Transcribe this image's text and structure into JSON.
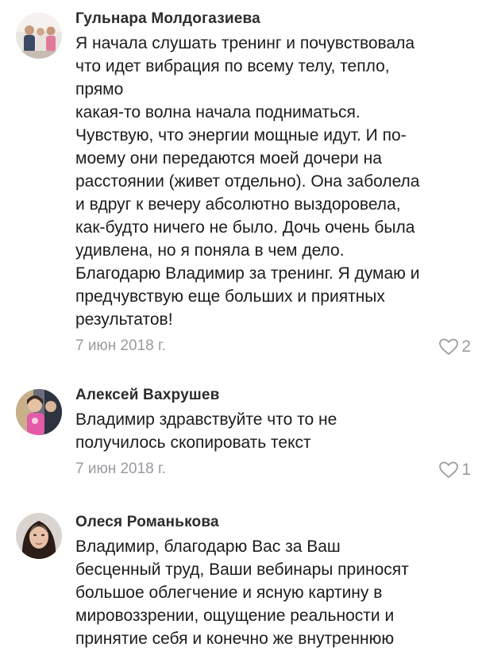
{
  "comments": [
    {
      "author": "Гульнара Молдогазиева",
      "text": "Я начала слушать тренинг и почувствовала\nчто идет вибрация по всему телу, тепло,\nпрямо\nкакая-то волна начала подниматься.\nЧувствую, что энергии мощные идут. И по-\nмоему они передаются моей дочери на\nрасстоянии (живет отдельно). Она заболела\nи вдруг к вечеру абсолютно выздоровела,\nкак-будто ничего не было. Дочь очень была\nудивлена, но я поняла в чем дело.\nБлагодарю Владимир за тренинг. Я думаю и\nпредчувствую еще больших и приятных\nрезультатов!",
      "date": "7 июн 2018 г.",
      "likes": "2"
    },
    {
      "author": "Алексей Вахрушев",
      "text": "Владимир здравствуйте   что то не\nполучилось скопировать текст",
      "date": "7 июн 2018 г.",
      "likes": "1"
    },
    {
      "author": "Олеся Романькова",
      "text": "Владимир, благодарю Вас за Ваш\nбесценный труд, Ваши вебинары приносят\nбольшое облегчение и ясную картину в\nмировоззрении, ощущение реальности и\nпринятие себя и конечно же внутреннюю",
      "date": "",
      "likes": ""
    }
  ],
  "icons": {
    "like": "heart-outline-icon",
    "avatar_1": "photo-avatar",
    "avatar_2": "photo-avatar",
    "avatar_3": "photo-avatar"
  },
  "colors": {
    "text": "#1c1c1e",
    "author": "#2b2b2d",
    "meta": "#9a9aa0",
    "background": "#ffffff"
  }
}
